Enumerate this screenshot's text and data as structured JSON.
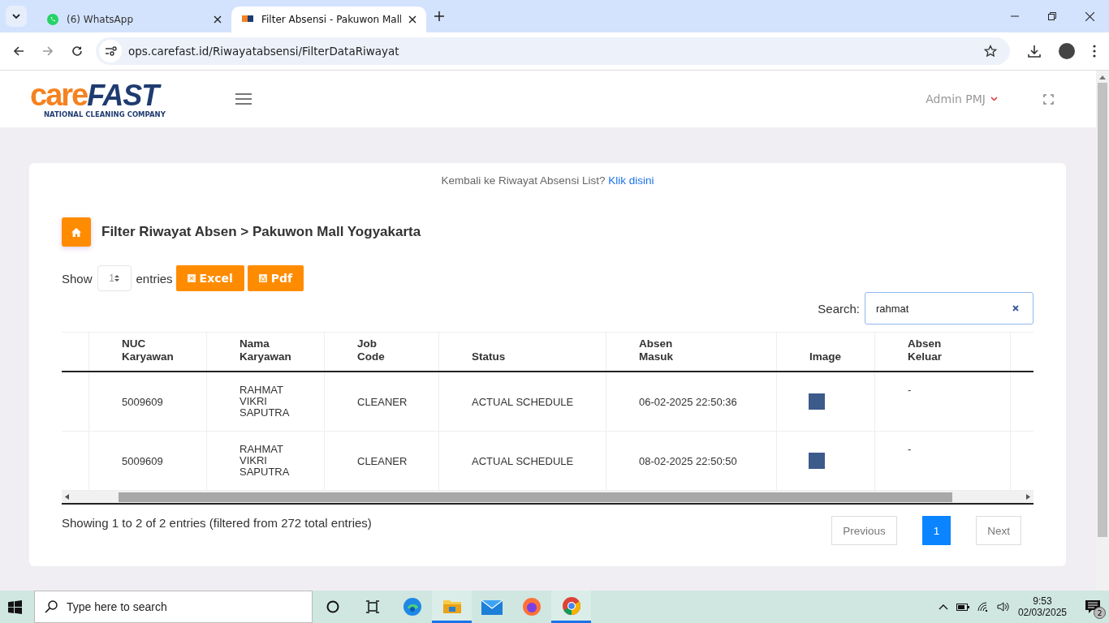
{
  "browser": {
    "tabs": [
      {
        "title": "(6) WhatsApp",
        "kind": "whatsapp",
        "selected": false
      },
      {
        "title": "Filter Absensi - Pakuwon Mall",
        "kind": "site",
        "selected": true
      }
    ],
    "url": "ops.carefast.id/Riwayatabsensi/FilterDataRiwayat"
  },
  "header": {
    "logo": {
      "word_1": "care",
      "word_2": "FAST",
      "tagline": "NATIONAL CLEANING COMPANY"
    },
    "user": "Admin PMJ"
  },
  "back_link": {
    "text": "Kembali ke Riwayat Absensi List?",
    "link": "Klik disini"
  },
  "breadcrumb": "Filter Riwayat Absen > Pakuwon Mall Yogyakarta",
  "length_control": {
    "label_before": "Show",
    "value": "1",
    "label_after": "entries"
  },
  "export_buttons": [
    {
      "label": "Excel",
      "kind": "excel"
    },
    {
      "label": "Pdf",
      "kind": "pdf"
    }
  ],
  "search": {
    "label": "Search:",
    "value": "rahmat"
  },
  "table": {
    "columns": [
      "",
      "NUC Karyawan",
      "Nama Karyawan",
      "Job Code",
      "Status",
      "Absen Masuk",
      "Image",
      "Absen Keluar",
      ""
    ],
    "rows": [
      {
        "nuc": "5009609",
        "nama": "RAHMAT VIKRI SAPUTRA",
        "job_code": "CLEANER",
        "status": "ACTUAL SCHEDULE",
        "absen_masuk": "06-02-2025 22:50:36",
        "absen_keluar": "-"
      },
      {
        "nuc": "5009609",
        "nama": "RAHMAT VIKRI SAPUTRA",
        "job_code": "CLEANER",
        "status": "ACTUAL SCHEDULE",
        "absen_masuk": "08-02-2025 22:50:50",
        "absen_keluar": "-"
      }
    ]
  },
  "info": "Showing 1 to 2 of 2 entries (filtered from 272 total entries)",
  "pagination": [
    {
      "label": "Previous",
      "selected": false
    },
    {
      "label": "1",
      "selected": true
    },
    {
      "label": "Next",
      "selected": false
    }
  ],
  "taskbar": {
    "search_placeholder": "Type here to search",
    "apps": [
      {
        "kind": "cortana",
        "active": false
      },
      {
        "kind": "taskview",
        "active": false
      },
      {
        "kind": "edge",
        "active": false
      },
      {
        "kind": "explorer",
        "active": true
      },
      {
        "kind": "mail",
        "active": false
      },
      {
        "kind": "firefox",
        "active": false
      },
      {
        "kind": "chrome",
        "active": true
      }
    ],
    "time": "9:53",
    "date": "02/03/2025",
    "notifications": "2"
  }
}
